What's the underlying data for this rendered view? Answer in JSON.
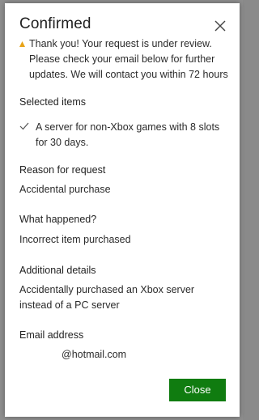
{
  "dialog": {
    "title": "Confirmed",
    "notice": "Thank you! Your request is under review. Please check your email below for further updates. We will contact you within 72 hours",
    "close_button_label": "Close"
  },
  "sections": {
    "selected_items": {
      "label": "Selected items",
      "item": "A server for non-Xbox games with 8 slots for 30 days."
    },
    "reason": {
      "label": "Reason for request",
      "value": "Accidental purchase"
    },
    "what_happened": {
      "label": "What happened?",
      "value": "Incorrect item purchased"
    },
    "additional_details": {
      "label": "Additional details",
      "value": "Accidentally purchased an Xbox server instead of a PC server"
    },
    "email": {
      "label": "Email address",
      "value": "@hotmail.com"
    }
  },
  "icons": {
    "close": "close-icon",
    "warning": "warning-icon",
    "check": "check-icon"
  },
  "colors": {
    "accent": "#107c10",
    "warning": "#e8a317",
    "backdrop": "#8e8e8e"
  }
}
